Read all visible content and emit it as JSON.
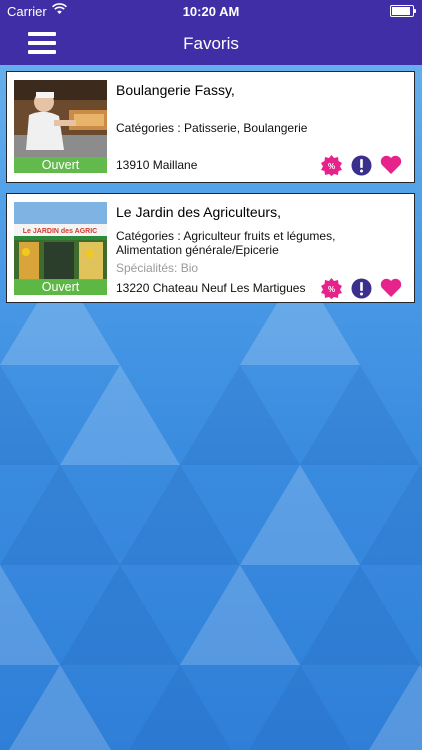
{
  "status_bar": {
    "carrier": "Carrier",
    "time": "10:20 AM",
    "battery_level": 1.0,
    "icons": [
      "wifi-icon",
      "battery-icon"
    ]
  },
  "nav": {
    "title": "Favoris",
    "menu_icon": "hamburger-menu-icon"
  },
  "colors": {
    "nav_background": "#3f2ea6",
    "open_badge": "#60be46",
    "promo_badge": "#e6238a",
    "info_icon": "#3b2f8e",
    "heart_icon": "#e6238a",
    "card_border": "#23262b"
  },
  "favorites": [
    {
      "name": "Boulangerie Fassy,",
      "status": "Ouvert",
      "categories": "Catégories : Patisserie, Boulangerie",
      "specialties": "",
      "address": "13910 Maillane",
      "icons": [
        "promo-badge-icon",
        "info-icon",
        "heart-icon"
      ]
    },
    {
      "name": "Le Jardin des Agriculteurs,",
      "status": "Ouvert",
      "categories": "Catégories : Agriculteur fruits et légumes, Alimentation générale/Epicerie",
      "specialties": "Spécialités: Bio",
      "address": "13220 Chateau Neuf Les Martigues",
      "icons": [
        "promo-badge-icon",
        "info-icon",
        "heart-icon"
      ]
    }
  ]
}
